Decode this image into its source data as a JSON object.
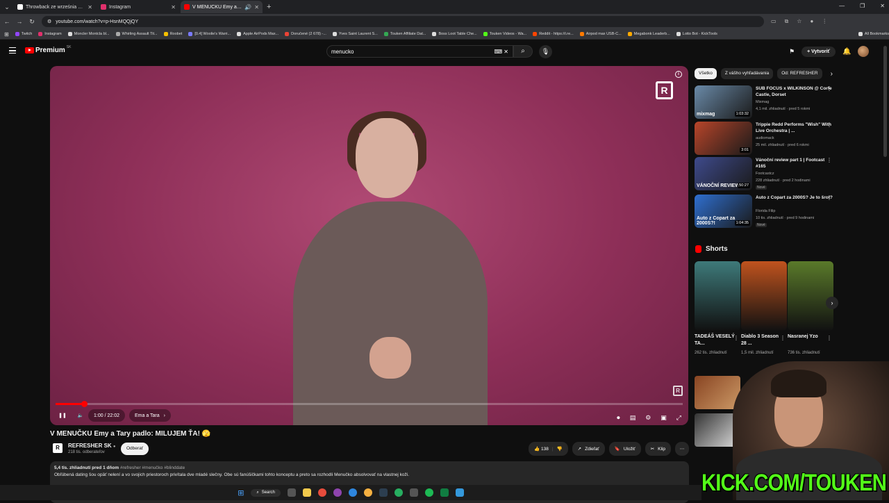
{
  "browser": {
    "tabs": [
      {
        "title": "Throwback ze września 😄🔥 #",
        "color": "#ffffff"
      },
      {
        "title": "Instagram",
        "color": "#e1306c"
      },
      {
        "title": "V MENUČKU Emy a Tary pa",
        "color": "#ff0000",
        "active": true
      }
    ],
    "new_tab": "+",
    "url": "youtube.com/watch?v=p-HsnMQQjQY",
    "bookmarks": [
      {
        "label": "Twitch",
        "color": "#9146ff"
      },
      {
        "label": "Instagram",
        "color": "#e1306c"
      },
      {
        "label": "Moncler Montcla bl...",
        "color": "#dddddd"
      },
      {
        "label": "Whirling Assault Tit...",
        "color": "#aaaaaa"
      },
      {
        "label": "Roobet",
        "color": "#f5c000"
      },
      {
        "label": "[0.4] Woolie's Warri...",
        "color": "#7a7aff"
      },
      {
        "label": "Apple AirPods Max...",
        "color": "#dddddd"
      },
      {
        "label": "Doručené (2 678) -...",
        "color": "#ea4335"
      },
      {
        "label": "Yves Saint Laurent S...",
        "color": "#dddddd"
      },
      {
        "label": "Touken Affiliate Dat...",
        "color": "#34a853"
      },
      {
        "label": "Boss Loot Table Che...",
        "color": "#dddddd"
      },
      {
        "label": "Touken Videos - Wa...",
        "color": "#53fc18"
      },
      {
        "label": "Reddit - https://i.re...",
        "color": "#ff4500"
      },
      {
        "label": "Airpod max USB-C...",
        "color": "#ff7a00"
      },
      {
        "label": "Megabonk Leaderb...",
        "color": "#ffaa00"
      },
      {
        "label": "Lotto Bot - KickTools",
        "color": "#dddddd"
      },
      {
        "label": "All Bookmarks",
        "color": "#dddddd"
      }
    ]
  },
  "youtube": {
    "logo": "Premium",
    "logo_region": "SK",
    "search_value": "menucko",
    "create_label": "Vytvoriť"
  },
  "player": {
    "time_current": "1:00",
    "time_total": "22:02",
    "time_display": "1:00 / 22:02",
    "chapter": "Ema a Tara",
    "progress_fraction": 0.045,
    "watermark": "R"
  },
  "video": {
    "title": "V MENUČKU Emy a Tary padlo: MILUJEM ŤA! 🫣",
    "channel": "REFRESHER SK",
    "subscribers": "218 tis. odberateľov",
    "subscribe_label": "Odberať",
    "likes": "138",
    "share_label": "Zdieľať",
    "save_label": "Uložiť",
    "clip_label": "Klip",
    "views_date": "5,4 tis. zhliadnutí  pred 1 dňom",
    "hashtags": "#refresher #menučko #blinddate",
    "description": "Obľúbená dating šou opäť nelení a vo svojich priestoroch privítala dve mladé slečny. Obe sú fanúšičkami tohto konceptu a preto sa rozhodli Menučko absolvovať na vlastnej koži."
  },
  "chips": [
    "Všetko",
    "Z vášho vyhľadávania",
    "Od: REFRESHER"
  ],
  "recommendations": [
    {
      "title": "SUB FOCUS x WILKINSON @ Corfe Castle, Dorset",
      "channel": "Mixmag",
      "meta": "4,1 mil. zhliadnutí · pred 5 rokmi",
      "duration": "1:03:32",
      "caption": "mixmag",
      "badge": "",
      "color": "#6a8aa8"
    },
    {
      "title": "Trippie Redd Performs \"Wish\" With Live Orchestra | ...",
      "channel": "audiomack",
      "meta": "25 mil. zhliadnutí · pred 6 rokmi",
      "duration": "3:01",
      "caption": "",
      "badge": "",
      "color": "#b8452a"
    },
    {
      "title": "Vánoční review part 1 | Footcast #165",
      "channel": "Footcastcz",
      "meta": "228 zhliadnutí · pred 2 hodinami",
      "duration": "50:27",
      "caption": "VÁNOČNÍ REVIEW",
      "badge": "Nové",
      "color": "#3e4a8c"
    },
    {
      "title": "Auto z Copart za 2000S? Je to šrot?",
      "channel": "Florida Filip",
      "meta": "10 tis. zhliadnutí · pred 9 hodinami",
      "duration": "1:04:35",
      "caption": "Auto z Copart za 2000S?!",
      "badge": "Nové",
      "color": "#2f6fd0"
    }
  ],
  "shorts": {
    "heading": "Shorts",
    "items": [
      {
        "title": "TADEÁŠ VESELÝ TA...",
        "views": "262 tis. zhliadnutí",
        "color": "#3e7a7a"
      },
      {
        "title": "Diablo 3 Season 28 ...",
        "views": "1,5 mil. zhliadnutí",
        "color": "#c0531e"
      },
      {
        "title": "Nasranej Yzo",
        "views": "736 tis. zhliadnutí",
        "color": "#5a7a2a"
      }
    ]
  },
  "overlay": {
    "kick": "KICK.COM/TOUKEN"
  },
  "taskbar": {
    "search_label": "Search"
  }
}
